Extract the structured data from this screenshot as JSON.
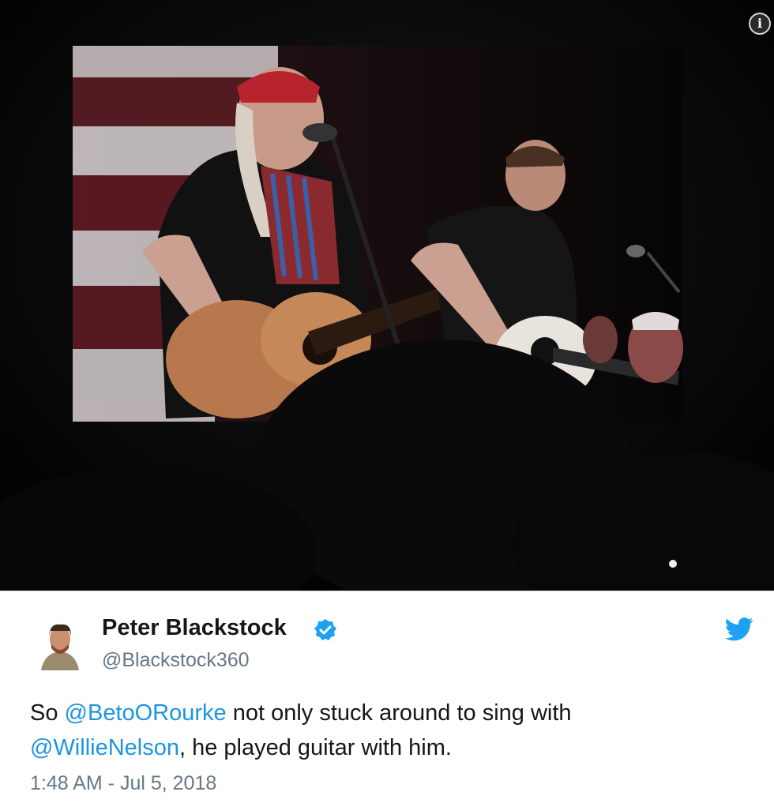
{
  "media": {
    "alt": "",
    "info_icon": "info-icon"
  },
  "tweet": {
    "author_name": "Peter Blackstock",
    "author_handle": "@Blackstock360",
    "verified_icon": "verified-badge-icon",
    "brand_icon": "twitter-bird-icon",
    "text_before": "So ",
    "mention_1": "@BetoORourke",
    "text_middle": " not only stuck around to sing with ",
    "mention_2": "@WillieNelson",
    "text_after": ", he played guitar with him.",
    "timestamp": "1:48 AM - Jul 5, 2018"
  },
  "colors": {
    "link": "#1b95e0",
    "secondary_text": "#657786",
    "primary_text": "#14171a",
    "media_background": "#050505"
  }
}
